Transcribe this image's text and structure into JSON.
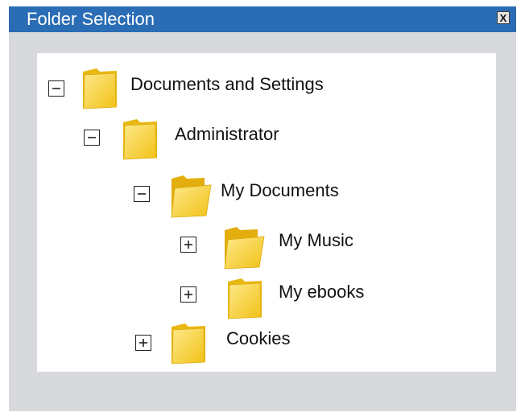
{
  "window": {
    "title": "Folder Selection",
    "close_label": "X",
    "titlebar_color": "#2a6db5"
  },
  "tree": [
    {
      "label": "Documents and Settings",
      "state": "expanded",
      "icon": "folder-closed-icon",
      "level": 0
    },
    {
      "label": "Administrator",
      "state": "expanded",
      "icon": "folder-closed-icon",
      "level": 1
    },
    {
      "label": "My Documents",
      "state": "expanded",
      "icon": "folder-open-icon",
      "level": 2
    },
    {
      "label": "My Music",
      "state": "collapsed",
      "icon": "folder-open-icon",
      "level": 3
    },
    {
      "label": "My ebooks",
      "state": "collapsed",
      "icon": "folder-closed-icon",
      "level": 3
    },
    {
      "label": "Cookies",
      "state": "collapsed",
      "icon": "folder-closed-icon",
      "level": 2
    }
  ]
}
